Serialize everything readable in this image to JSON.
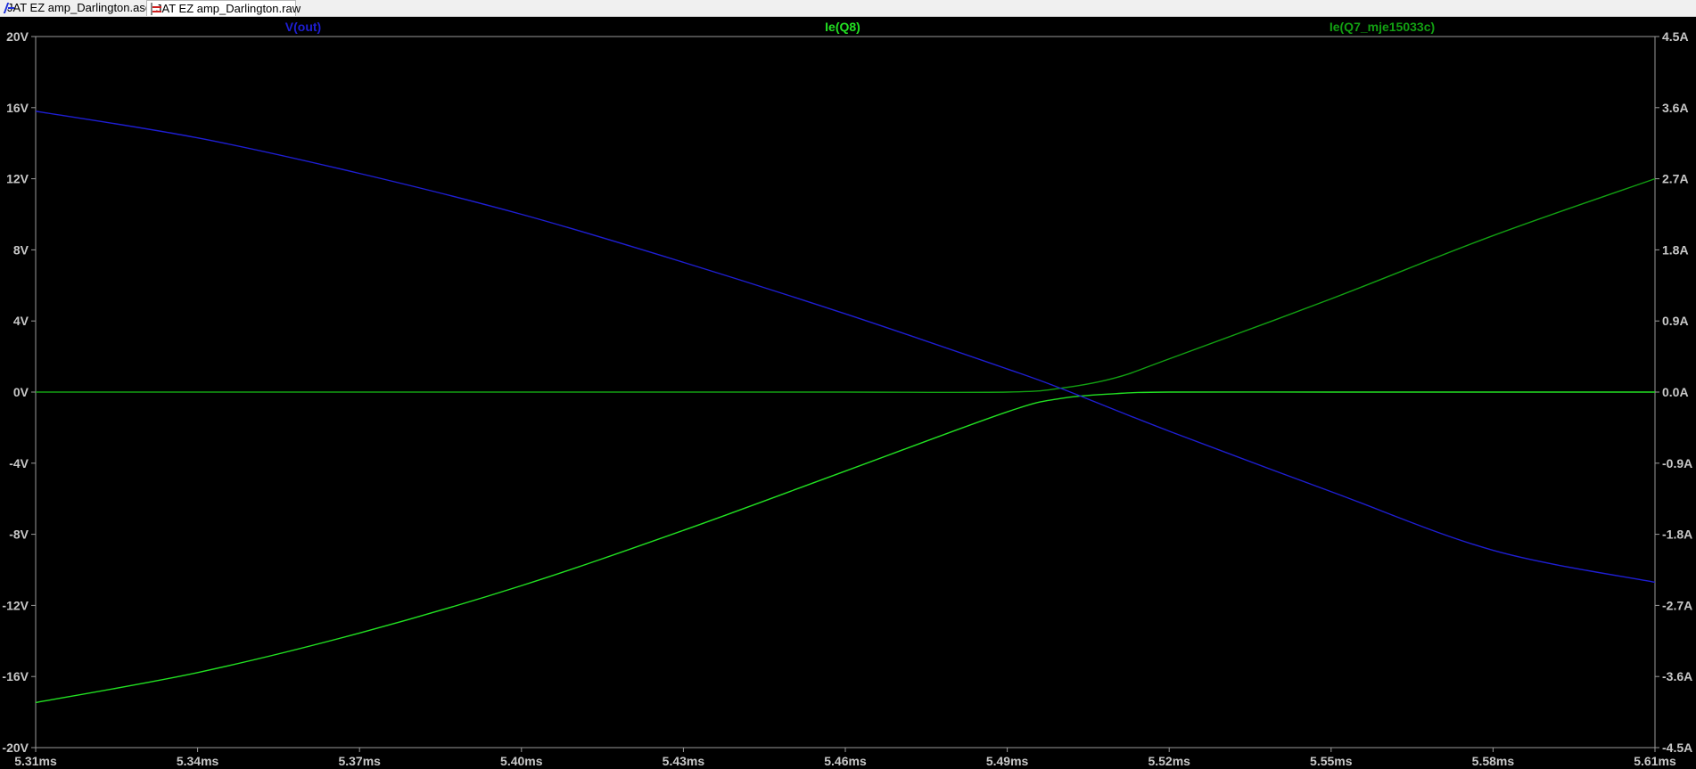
{
  "tabs": [
    {
      "label": "JAT EZ amp_Darlington.asc",
      "icon": "schematic-icon"
    },
    {
      "label": "JAT EZ amp_Darlington.raw",
      "icon": "waveform-icon",
      "active": true
    }
  ],
  "colors": {
    "background": "#000000",
    "axis": "#9a9a9a",
    "tick_text": "#c8c8c8",
    "vout": "#1e1ed2",
    "ie_q8": "#22e022",
    "ie_q7": "#12a012"
  },
  "chart_data": {
    "type": "line",
    "legend": "top",
    "grid": false,
    "x": {
      "range": [
        5.31,
        5.61
      ],
      "ticks": [
        "5.31ms",
        "5.34ms",
        "5.37ms",
        "5.40ms",
        "5.43ms",
        "5.46ms",
        "5.49ms",
        "5.52ms",
        "5.55ms",
        "5.58ms",
        "5.61ms"
      ]
    },
    "y_left": {
      "range": [
        -20,
        20
      ],
      "ticks": [
        "20V",
        "16V",
        "12V",
        "8V",
        "4V",
        "0V",
        "-4V",
        "-8V",
        "-12V",
        "-16V",
        "-20V"
      ]
    },
    "y_right": {
      "range": [
        -4.5,
        4.5
      ],
      "ticks": [
        "4.5A",
        "3.6A",
        "2.7A",
        "1.8A",
        "0.9A",
        "0.0A",
        "-0.9A",
        "-1.8A",
        "-2.7A",
        "-3.6A",
        "-4.5A"
      ]
    },
    "series": [
      {
        "name": "V(out)",
        "axis": "left",
        "color": "#1e1ed2",
        "x": [
          5.31,
          5.34,
          5.37,
          5.4,
          5.43,
          5.46,
          5.49,
          5.5,
          5.52,
          5.55,
          5.58,
          5.61
        ],
        "y": [
          15.8,
          14.3,
          12.3,
          10.0,
          7.3,
          4.4,
          1.3,
          0.2,
          -2.2,
          -5.6,
          -8.9,
          -10.7
        ]
      },
      {
        "name": "Ie(Q8)",
        "axis": "right",
        "color": "#22e022",
        "x": [
          5.31,
          5.34,
          5.37,
          5.4,
          5.43,
          5.46,
          5.49,
          5.5,
          5.51,
          5.52,
          5.55,
          5.58,
          5.61
        ],
        "y": [
          -3.93,
          -3.55,
          -3.05,
          -2.45,
          -1.75,
          -1.0,
          -0.25,
          -0.08,
          -0.02,
          0.0,
          0.0,
          0.0,
          0.0
        ]
      },
      {
        "name": "Ie(Q7_mje15033c)",
        "axis": "right",
        "color": "#12a012",
        "x": [
          5.31,
          5.34,
          5.37,
          5.4,
          5.43,
          5.46,
          5.49,
          5.5,
          5.51,
          5.52,
          5.55,
          5.58,
          5.61
        ],
        "y": [
          0.0,
          0.0,
          0.0,
          0.0,
          0.0,
          0.0,
          0.0,
          0.05,
          0.18,
          0.42,
          1.18,
          1.98,
          2.7
        ]
      }
    ]
  }
}
